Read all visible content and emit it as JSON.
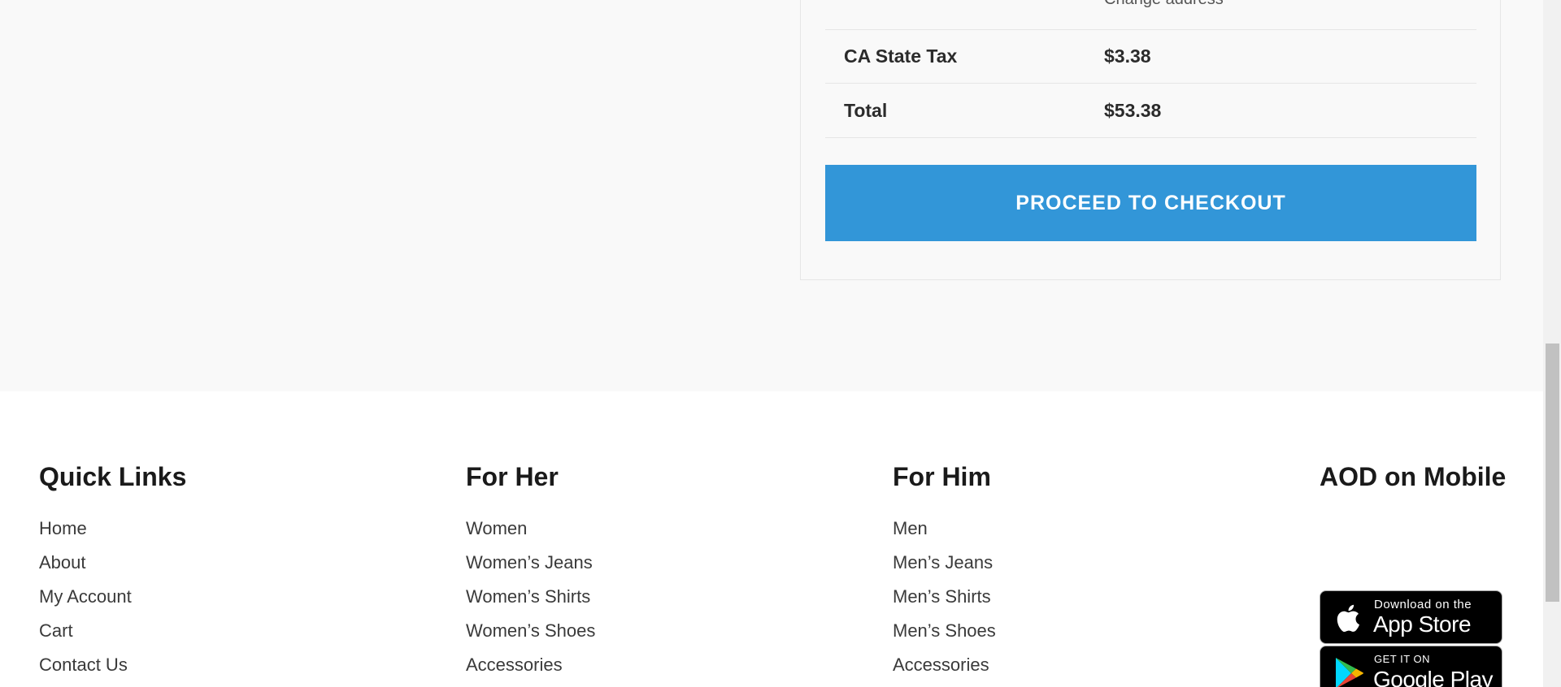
{
  "cart_totals": {
    "change_address_link": "Change address",
    "tax": {
      "label": "CA State Tax",
      "value": "$3.38"
    },
    "total": {
      "label": "Total",
      "value": "$53.38"
    },
    "checkout_button": "PROCEED TO CHECKOUT",
    "button_color": "#3296d8"
  },
  "footer": {
    "quick_links": {
      "heading": "Quick Links",
      "items": [
        "Home",
        "About",
        "My Account",
        "Cart",
        "Contact Us"
      ]
    },
    "for_her": {
      "heading": "For Her",
      "items": [
        "Women",
        "Women’s Jeans",
        "Women’s Shirts",
        "Women’s Shoes",
        "Accessories"
      ]
    },
    "for_him": {
      "heading": "For Him",
      "items": [
        "Men",
        "Men’s Jeans",
        "Men’s Shirts",
        "Men’s Shoes",
        "Accessories"
      ]
    },
    "mobile": {
      "heading": "AOD on Mobile",
      "app_store": {
        "icon": "apple-icon",
        "small": "Download on the",
        "big": "App Store"
      },
      "google_play": {
        "icon": "google-play-icon",
        "small": "GET IT ON",
        "big": "Google Play"
      }
    }
  }
}
